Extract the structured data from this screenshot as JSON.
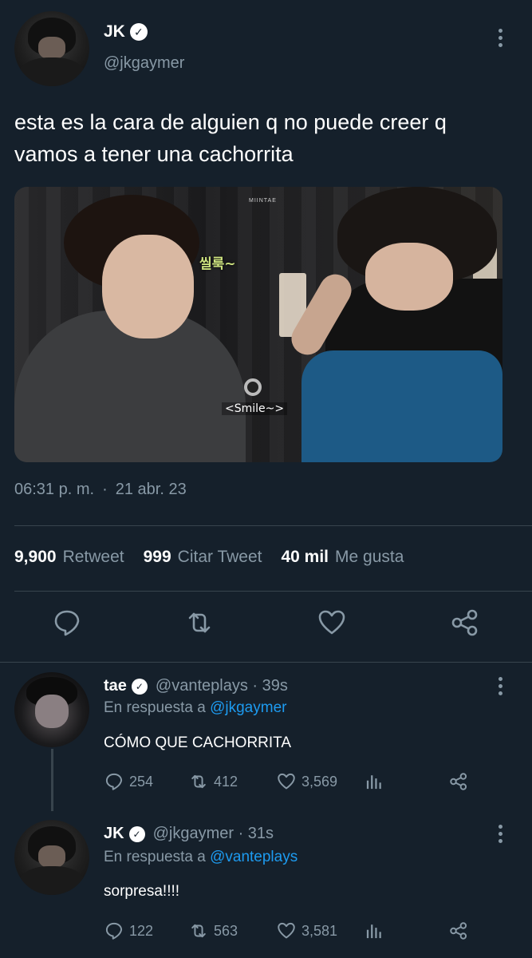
{
  "main_tweet": {
    "display_name": "JK",
    "verified_mark": "✓",
    "handle": "@jkgaymer",
    "text": "esta es la cara de alguien q no puede creer q vamos a tener una cachorrita",
    "media": {
      "caption_korean": "씰룩~",
      "caption_smile": "<Smile~>",
      "watermark": "MIINTAE"
    },
    "time": "06:31 p. m.",
    "separator": "·",
    "date": "21 abr. 23",
    "stats": {
      "retweets_value": "9,900",
      "retweets_label": "Retweet",
      "quotes_value": "999",
      "quotes_label": "Citar Tweet",
      "likes_value": "40 mil",
      "likes_label": "Me gusta"
    },
    "actions": [
      "reply-icon",
      "retweet-icon",
      "like-icon",
      "share-icon"
    ]
  },
  "replies": [
    {
      "display_name": "tae",
      "verified_mark": "✓",
      "handle_time": "@vanteplays · 39s",
      "reply_to_prefix": "En respuesta a",
      "reply_to_handle": "@jkgaymer",
      "text": "CÓMO QUE CACHORRITA",
      "reply_count": "254",
      "retweet_count": "412",
      "like_count": "3,569"
    },
    {
      "display_name": "JK",
      "verified_mark": "✓",
      "handle_time": "@jkgaymer · 31s",
      "reply_to_prefix": "En respuesta a",
      "reply_to_handle": "@vanteplays",
      "text": "sorpresa!!!!",
      "reply_count": "122",
      "retweet_count": "563",
      "like_count": "3,581"
    }
  ],
  "colors": {
    "background": "#15202b",
    "secondary_text": "#8899a6",
    "link": "#1d9bf0",
    "divider": "#38444d"
  }
}
